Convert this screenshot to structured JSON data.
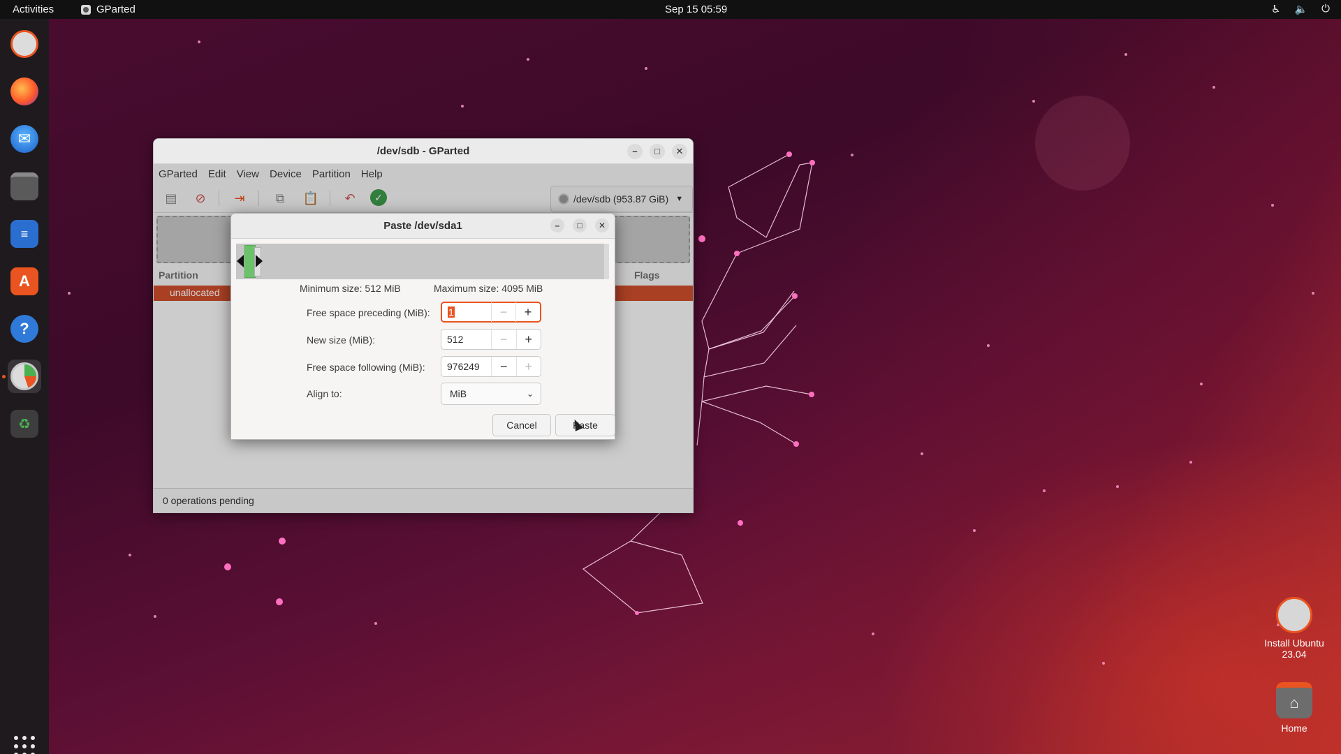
{
  "topbar": {
    "activities": "Activities",
    "app_name": "GParted",
    "clock": "Sep 15  05:59",
    "tray_icons": [
      "accessibility-icon",
      "volume-icon",
      "power-icon"
    ]
  },
  "dock": {
    "items": [
      "ubuntu-installer-icon",
      "firefox-icon",
      "thunderbird-icon",
      "files-icon",
      "libreoffice-writer-icon",
      "app-center-icon",
      "help-icon",
      "gparted-icon",
      "trash-icon"
    ],
    "show_apps": "show-apps-icon"
  },
  "desktop": {
    "icons": [
      {
        "label": "Install Ubuntu\n23.04"
      },
      {
        "label": "Home"
      }
    ],
    "install_label_line1": "Install Ubuntu",
    "install_label_line2": "23.04",
    "home_label": "Home"
  },
  "gparted": {
    "title": "/dev/sdb - GParted",
    "menu": [
      "GParted",
      "Edit",
      "View",
      "Device",
      "Partition",
      "Help"
    ],
    "device": "/dev/sdb (953.87 GiB)",
    "columns": {
      "partition": "Partition",
      "flags": "Flags"
    },
    "row_unallocated": "unallocated",
    "status": "0 operations pending"
  },
  "dialog": {
    "title": "Paste /dev/sda1",
    "min_size": "Minimum size: 512 MiB",
    "max_size": "Maximum size: 4095 MiB",
    "fields": {
      "preceding_label": "Free space preceding (MiB):",
      "preceding_value": "1",
      "new_size_label": "New size (MiB):",
      "new_size_value": "512",
      "following_label": "Free space following (MiB):",
      "following_value": "976249",
      "align_label": "Align to:",
      "align_value": "MiB"
    },
    "cancel": "Cancel",
    "paste": "Paste"
  },
  "colors": {
    "accent": "#e95420",
    "partition_green": "#6cc26a",
    "unallocated_row": "#cf4e2b"
  }
}
